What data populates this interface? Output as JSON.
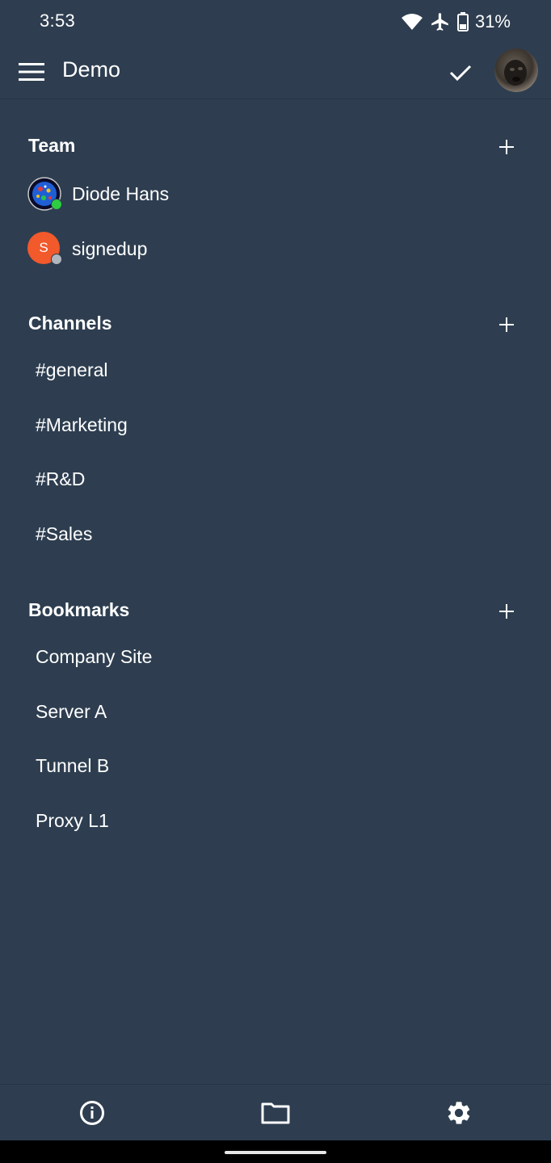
{
  "status_bar": {
    "time": "3:53",
    "battery_percent": "31%",
    "icons": [
      "wifi-icon",
      "airplane-icon",
      "battery-icon"
    ]
  },
  "app_bar": {
    "title": "Demo",
    "icons": [
      "menu-icon",
      "check-icon",
      "profile-avatar"
    ]
  },
  "team": {
    "title": "Team",
    "members": [
      {
        "name": "Diode Hans",
        "status": "online",
        "status_color": "#2ecc40"
      },
      {
        "name": "signedup",
        "avatar_letter": "S",
        "avatar_color": "#f2592b",
        "status": "offline",
        "status_color": "#b0b6bd"
      }
    ]
  },
  "channels": {
    "title": "Channels",
    "items": [
      "#general",
      "#Marketing",
      "#R&D",
      "#Sales"
    ]
  },
  "bookmarks": {
    "title": "Bookmarks",
    "items": [
      "Company Site",
      "Server A",
      "Tunnel B",
      "Proxy L1"
    ]
  },
  "bottom_nav": {
    "icons": [
      "info-icon",
      "folder-icon",
      "gear-icon"
    ]
  },
  "colors": {
    "background": "#2e3e50",
    "divider": "#263445",
    "text": "#ffffff"
  }
}
